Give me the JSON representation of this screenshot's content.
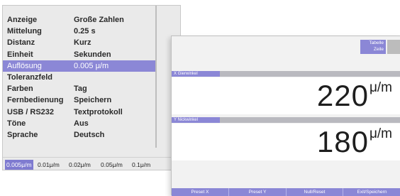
{
  "menu": {
    "rows": [
      {
        "label": "Anzeige",
        "value": "Große Zahlen"
      },
      {
        "label": "Mittelung",
        "value": "0.25 s"
      },
      {
        "label": "Distanz",
        "value": "Kurz"
      },
      {
        "label": "Einheit",
        "value": "Sekunden"
      },
      {
        "label": "Auflösung",
        "value": "0.005 μ/m"
      },
      {
        "label": "Toleranzfeld",
        "value": ""
      },
      {
        "label": "Farben",
        "value": "Tag"
      },
      {
        "label": "Fernbedienung",
        "value": "Speichern"
      },
      {
        "label": "USB / RS232",
        "value": "Textprotokoll"
      },
      {
        "label": "Töne",
        "value": "Aus"
      },
      {
        "label": "Sprache",
        "value": "Deutsch"
      }
    ],
    "selected_index": 4,
    "resolution_options": [
      "0.005μ/m",
      "0.01μ/m",
      "0.02μ/m",
      "0.05μ/m",
      "0.1μ/m"
    ],
    "resolution_active_index": 0
  },
  "measure": {
    "table_button": {
      "line1": "Tabelle",
      "line2": "Zeile"
    },
    "x": {
      "label": "X Gierwinkel",
      "value": "220",
      "unit": "μ/m"
    },
    "y": {
      "label": "Y Nickwinkel",
      "value": "180",
      "unit": "μ/m"
    },
    "softkeys": [
      "Preset X",
      "Preset Y",
      "Null/Reset",
      "Exit/Speichern"
    ]
  },
  "colors": {
    "accent": "#8b87d6",
    "panel_header": "#b9b9bf",
    "background": "#eaeaea"
  }
}
